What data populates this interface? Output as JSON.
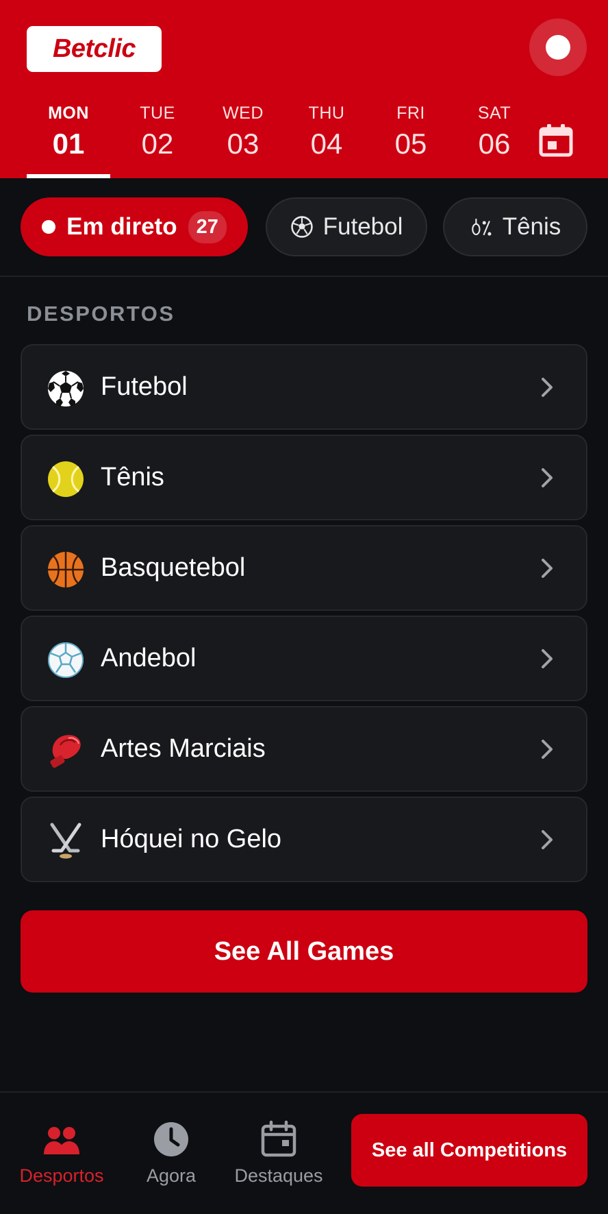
{
  "header": {
    "logo_text": "Betclic",
    "brand_color": "#cc0011"
  },
  "days": [
    {
      "name": "MON",
      "num": "01",
      "active": true
    },
    {
      "name": "TUE",
      "num": "02"
    },
    {
      "name": "WED",
      "num": "03"
    },
    {
      "name": "THU",
      "num": "04"
    },
    {
      "name": "FRI",
      "num": "05"
    },
    {
      "name": "SAT",
      "num": "06"
    }
  ],
  "chips": {
    "live_label": "Em direto",
    "live_count": "27",
    "football_label": "Futebol",
    "tennis_label": "Tênis"
  },
  "sports": {
    "section_title": "DESPORTOS",
    "items": [
      {
        "label": "Futebol",
        "icon": "soccer-ball-icon"
      },
      {
        "label": "Tênis",
        "icon": "tennis-ball-icon"
      },
      {
        "label": "Basquetebol",
        "icon": "basketball-icon"
      },
      {
        "label": "Andebol",
        "icon": "handball-icon"
      },
      {
        "label": "Artes Marciais",
        "icon": "boxing-glove-icon"
      },
      {
        "label": "Hóquei no Gelo",
        "icon": "ice-hockey-icon"
      }
    ]
  },
  "see_all_games_label": "See All Games",
  "bottom_nav": {
    "items": [
      {
        "label": "Desportos",
        "icon": "people-icon",
        "active": true
      },
      {
        "label": "Agora",
        "icon": "clock-icon"
      },
      {
        "label": "Destaques",
        "icon": "calendar-icon"
      }
    ],
    "competitions_label": "See all Competitions"
  }
}
